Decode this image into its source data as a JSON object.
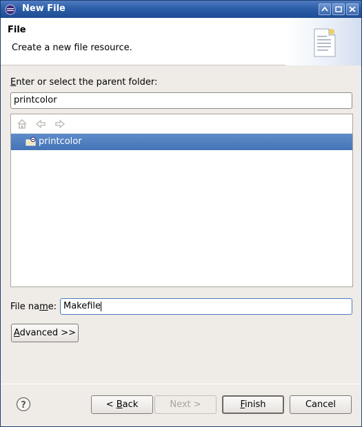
{
  "window": {
    "title": "New File",
    "icons": {
      "app": "eclipse-icon",
      "minimize": "minimize-icon",
      "maximize": "maximize-icon",
      "close": "close-icon"
    }
  },
  "header": {
    "title": "File",
    "description": "Create a new file resource.",
    "icon": "new-file-document-icon"
  },
  "parent_folder": {
    "label_mnemonic": "E",
    "label_rest": "nter or select the parent folder:",
    "value": "printcolor"
  },
  "tree": {
    "toolbar_icons": [
      "home-icon",
      "back-arrow-icon",
      "forward-arrow-icon"
    ],
    "items": [
      {
        "label": "printcolor",
        "icon": "project-folder-icon",
        "selected": true
      }
    ]
  },
  "file_name": {
    "label_pre": "File na",
    "label_mnemonic": "m",
    "label_post": "e:",
    "value": "Makefile"
  },
  "advanced_button": {
    "mnemonic": "A",
    "rest": "dvanced >>"
  },
  "footer": {
    "help_icon": "help-icon",
    "back": {
      "pre": "< ",
      "mnemonic": "B",
      "rest": "ack"
    },
    "next": {
      "label": "Next >"
    },
    "finish": {
      "mnemonic": "F",
      "rest": "inish"
    },
    "cancel": {
      "label": "Cancel"
    }
  },
  "colors": {
    "title_bar": "#2c5ea8",
    "selection": "#4a7bbd",
    "dialog_bg": "#efebe7"
  }
}
